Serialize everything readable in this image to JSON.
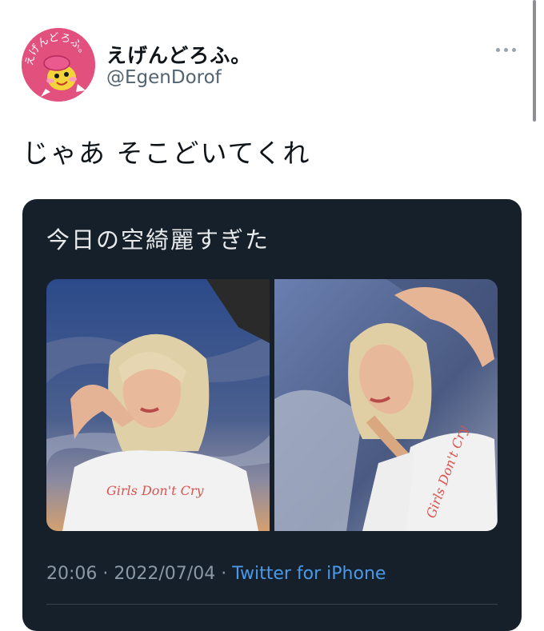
{
  "user": {
    "display_name": "えげんどろふ。",
    "handle": "@EgenDorof",
    "avatar_text": "えげんどろふ。",
    "avatar_icon": "pink-mascot-avatar"
  },
  "tweet": {
    "text": "じゃあ そこどいてくれ"
  },
  "quoted_tweet": {
    "text": "今日の空綺麗すぎた",
    "photos": [
      {
        "icon": "selfie-photo-1",
        "shirt_text": "Girls Don't Cry"
      },
      {
        "icon": "selfie-photo-2",
        "shirt_text": "Girls Don't Cry"
      }
    ],
    "time": "20:06",
    "date": "2022/07/04",
    "separator": " · ",
    "source": "Twitter for iPhone"
  },
  "icons": {
    "more": "more-horizontal-icon"
  },
  "colors": {
    "card_bg": "#15202b",
    "link": "#4a99e9",
    "avatar_bg": "#e2507e"
  }
}
